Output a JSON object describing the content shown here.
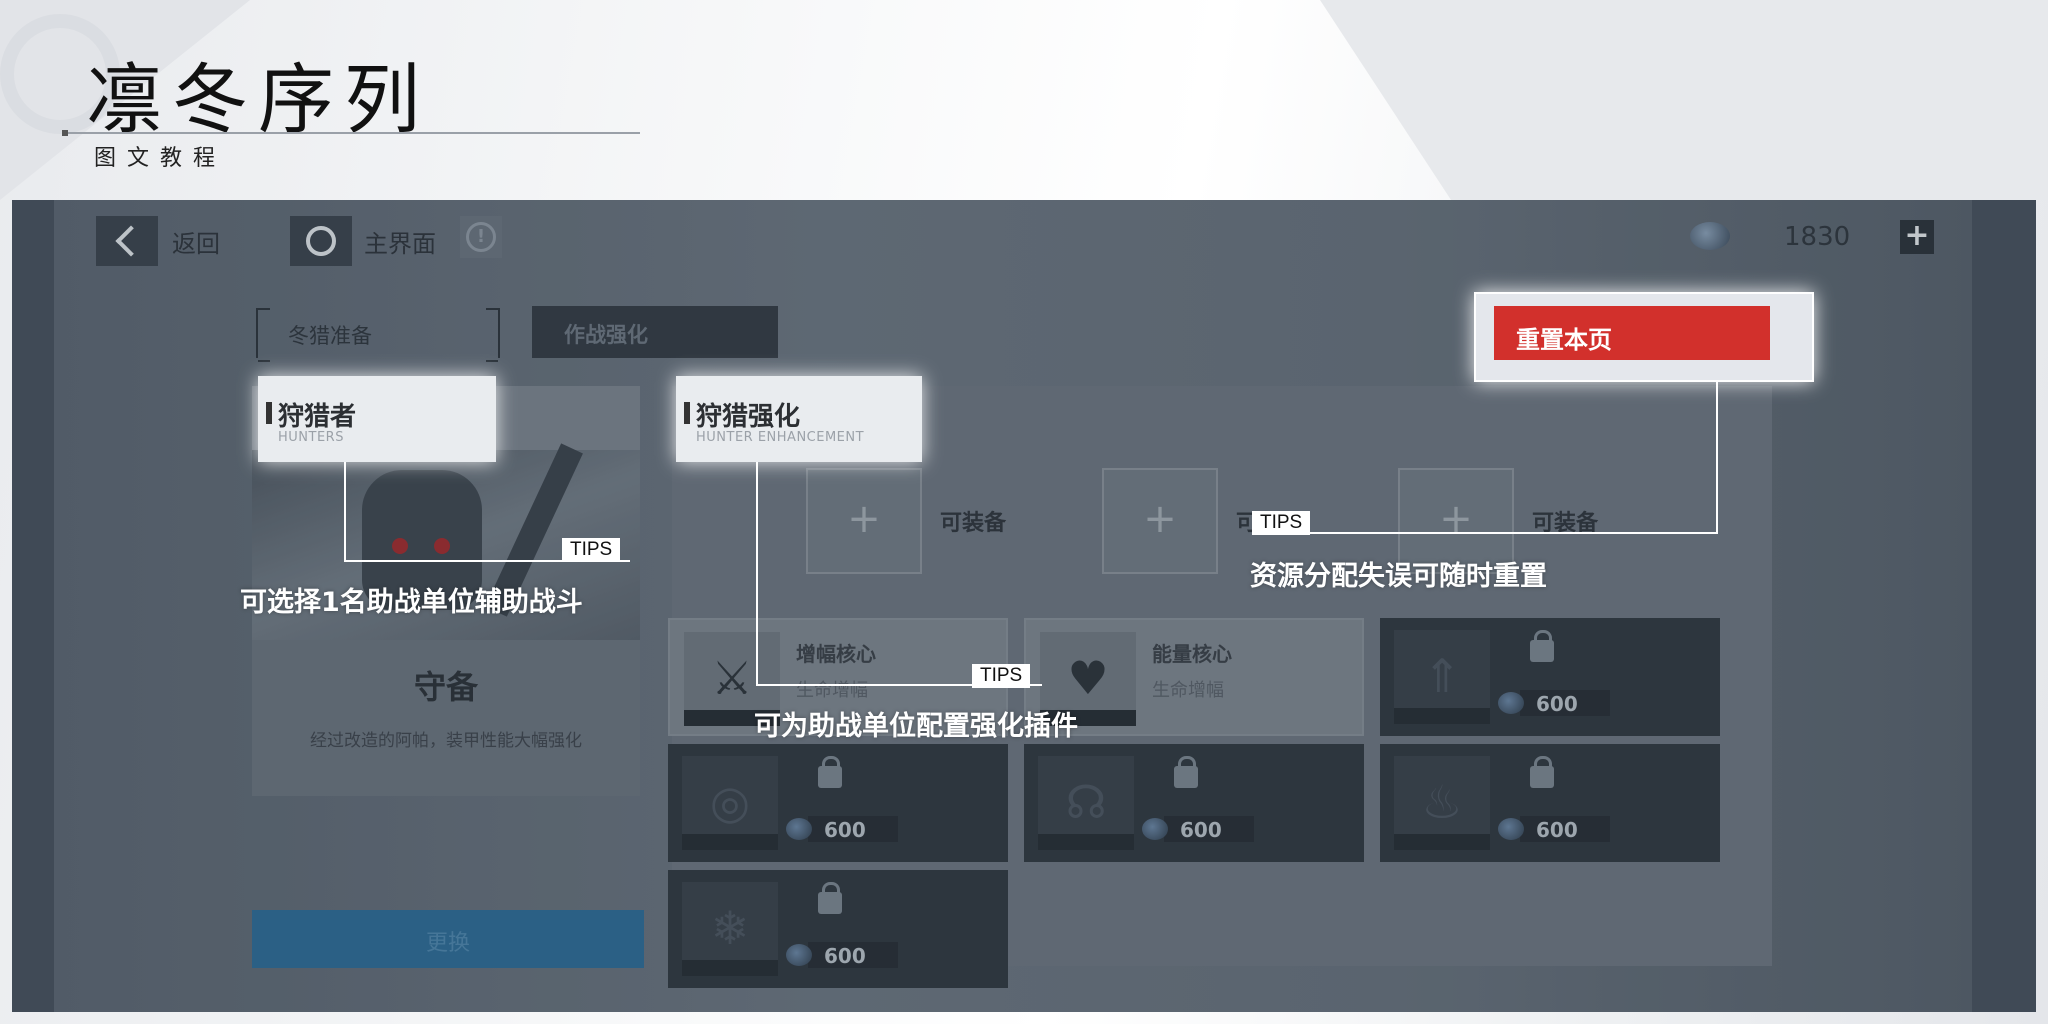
{
  "slide": {
    "title": "凛冬序列",
    "subtitle": "图文教程"
  },
  "topbar": {
    "back_label": "返回",
    "home_label": "主界面",
    "info_glyph": "!",
    "currency_value": "1830",
    "add_glyph": "+"
  },
  "tabs": {
    "prep": "冬猎准备",
    "combat": "作战强化"
  },
  "hunter": {
    "header_name": "狩猎者",
    "header_sub": "HUNTERS",
    "unit_name": "守备",
    "unit_desc": "经过改造的阿帕，装甲性能大幅强化",
    "change_label": "更换"
  },
  "enhancement": {
    "header_name": "狩猎强化",
    "header_sub": "HUNTER ENHANCEMENT",
    "slots": [
      {
        "label": "可装备"
      },
      {
        "label": "可"
      },
      {
        "label": "可装备"
      }
    ],
    "plugins": [
      {
        "name": "增幅核心",
        "sub": "生命增幅",
        "icon": "crossed-swords-icon",
        "glyph": "⚔",
        "locked": false
      },
      {
        "name": "能量核心",
        "sub": "生命增幅",
        "icon": "pixel-heart-icon",
        "glyph": "♥",
        "locked": false
      },
      {
        "name": "",
        "sub": "",
        "icon": "arrows-up-icon",
        "glyph": "⇑",
        "locked": true,
        "cost": "600"
      },
      {
        "name": "",
        "sub": "",
        "icon": "target-icon",
        "glyph": "◎",
        "locked": true,
        "cost": "600"
      },
      {
        "name": "",
        "sub": "",
        "icon": "helmet-icon",
        "glyph": "☊",
        "locked": true,
        "cost": "600"
      },
      {
        "name": "",
        "sub": "",
        "icon": "flame-icon",
        "glyph": "♨",
        "locked": true,
        "cost": "600"
      },
      {
        "name": "",
        "sub": "",
        "icon": "snowflake-icon",
        "glyph": "❄",
        "locked": true,
        "cost": "600"
      }
    ]
  },
  "reset": {
    "label": "重置本页"
  },
  "annotations": {
    "tips_label": "TIPS",
    "hunter_tip": "可选择1名助战单位辅助战斗",
    "enhance_tip": "可为助战单位配置强化插件",
    "reset_tip": "资源分配失误可随时重置"
  },
  "colors": {
    "reset_red": "#d2302c",
    "change_blue": "#2d6b96",
    "panel_gray": "#6c7580"
  }
}
